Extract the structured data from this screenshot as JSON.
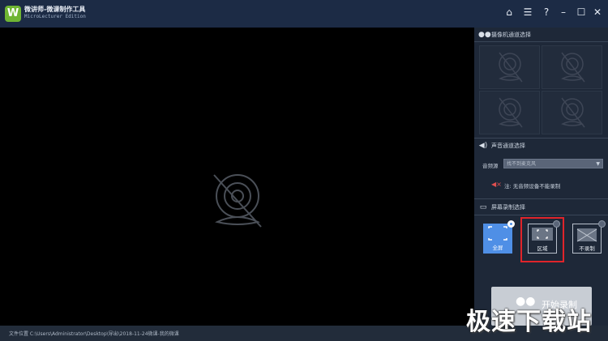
{
  "app": {
    "title": "微讲师-微课制作工具",
    "subtitle": "MicroLecturer Edition"
  },
  "window_controls": [
    {
      "name": "home-icon",
      "glyph": "⌂"
    },
    {
      "name": "menu-icon",
      "glyph": "☰"
    },
    {
      "name": "help-icon",
      "glyph": "?"
    },
    {
      "name": "minimize-icon",
      "glyph": "–"
    },
    {
      "name": "maximize-icon",
      "glyph": "☐"
    },
    {
      "name": "close-icon",
      "glyph": "✕"
    }
  ],
  "camera_section": {
    "title": "摄像机通道选择",
    "icon": "camera-group-icon"
  },
  "audio_section": {
    "title": "声音通道选择",
    "icon": "speaker-icon",
    "source_label": "音频源",
    "source_value": "找不到麦克风",
    "note": "注: 无音频设备不能录制"
  },
  "screen_section": {
    "title": "屏幕录制选择",
    "icon": "monitor-icon",
    "modes": [
      {
        "key": "fullscreen",
        "label": "全屏"
      },
      {
        "key": "region",
        "label": "区域"
      },
      {
        "key": "no-record",
        "label": "不录制"
      }
    ]
  },
  "start_button": {
    "label": "开始录制"
  },
  "status": {
    "file_location": "文件位置 C:\\Users\\Administrator\\Desktop\\导出\\2018-11-24微课-我的微课"
  },
  "watermark": {
    "text": "极速下载站"
  },
  "colors": {
    "titlebar": "#1c2b45",
    "panel": "#1e2838",
    "accent_blue": "#4f8fe6",
    "highlight_red": "#e0242a"
  }
}
